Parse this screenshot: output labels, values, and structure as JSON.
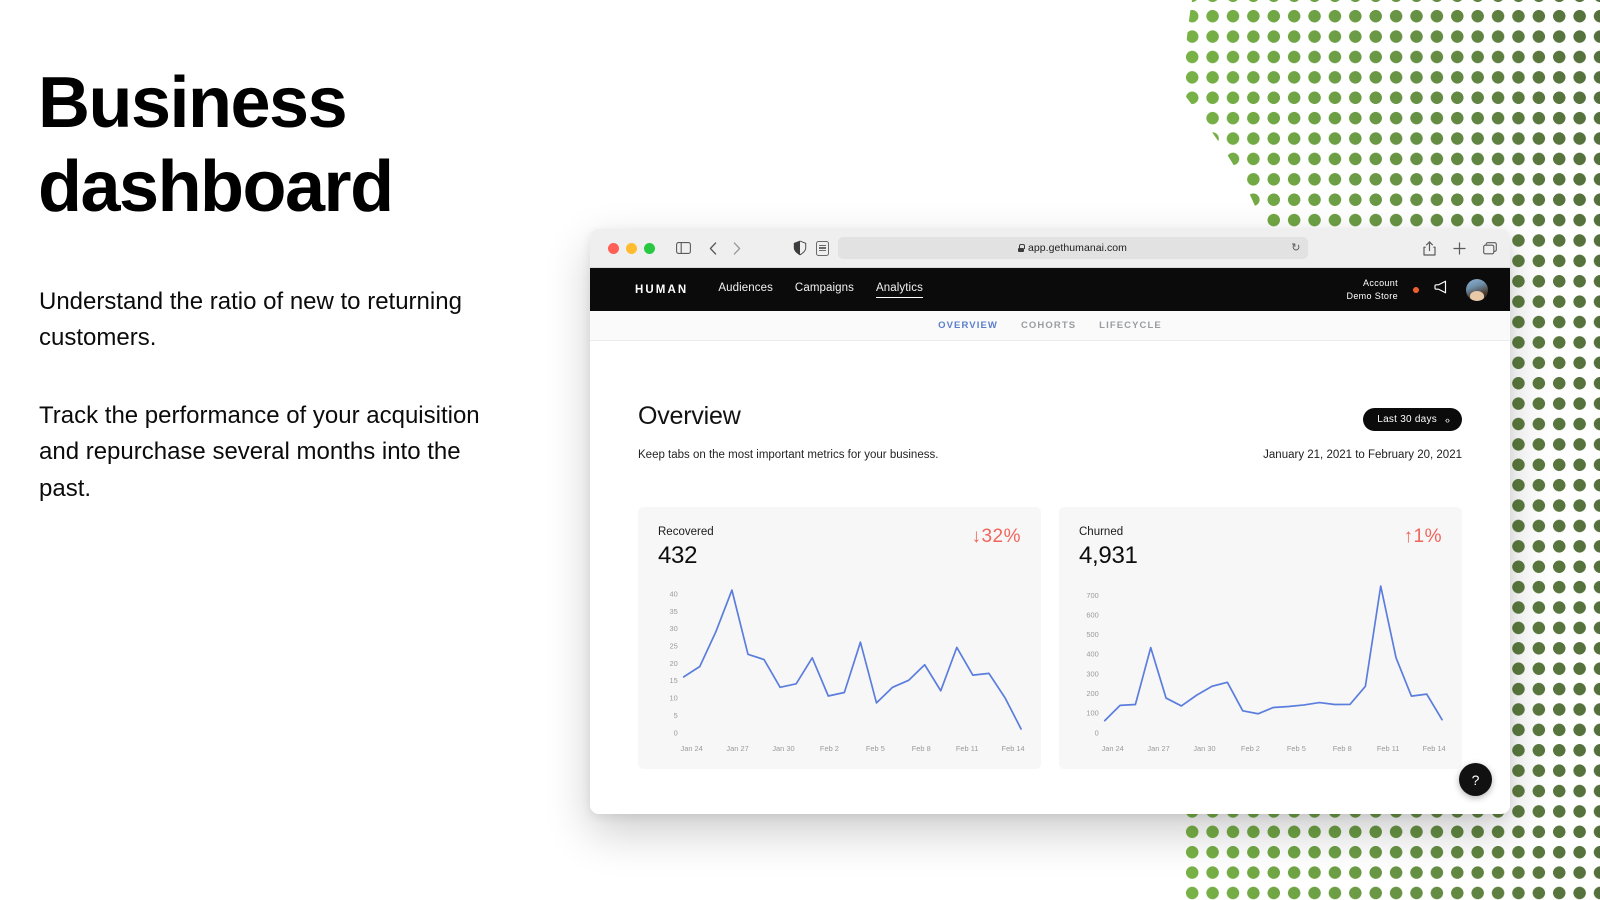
{
  "hero": {
    "title_line1": "Business",
    "title_line2": "dashboard",
    "paragraph1": "Understand the ratio of new to returning customers.",
    "paragraph2": "Track the performance of your acquisition and repurchase several months into the past."
  },
  "browser": {
    "url": "app.gethumanai.com",
    "reload_glyph": "↻",
    "share_glyph": "↑",
    "newtab_glyph": "+",
    "tabs_glyph": "⧉",
    "back_glyph": "‹",
    "forward_glyph": "›"
  },
  "appnav": {
    "logo": "HUMAN",
    "links": [
      {
        "label": "Audiences",
        "active": false
      },
      {
        "label": "Campaigns",
        "active": false
      },
      {
        "label": "Analytics",
        "active": true
      }
    ],
    "account_label": "Account",
    "account_store": "Demo Store"
  },
  "subtabs": [
    {
      "label": "OVERVIEW",
      "active": true
    },
    {
      "label": "COHORTS",
      "active": false
    },
    {
      "label": "LIFECYCLE",
      "active": false
    }
  ],
  "overview": {
    "title": "Overview",
    "subtitle": "Keep tabs on the most important metrics for your business.",
    "date_pill": "Last 30 days",
    "date_pill_chevrons": "‹›",
    "date_range": "January 21, 2021 to February 20, 2021"
  },
  "help_button": {
    "label": "?"
  },
  "colors": {
    "accent_line": "#5b7ddd",
    "delta_red": "#f0655c",
    "tab_active": "#5b7ecb",
    "nav_bg": "#0b0b0b",
    "card_bg": "#f7f7f7",
    "dot_green_light": "#79B347",
    "dot_green_dark": "#546F3C"
  },
  "cards": [
    {
      "label": "Recovered",
      "value": "432",
      "delta": "↓32%",
      "delta_direction": "down"
    },
    {
      "label": "Churned",
      "value": "4,931",
      "delta": "↑1%",
      "delta_direction": "up"
    }
  ],
  "chart_data": [
    {
      "type": "line",
      "title": "Recovered",
      "xlabel": "",
      "ylabel": "",
      "ylim": [
        0,
        43
      ],
      "yticks": [
        0,
        5,
        10,
        15,
        20,
        25,
        30,
        35,
        40
      ],
      "xticks": [
        "Jan 24",
        "Jan 27",
        "Jan 30",
        "Feb 2",
        "Feb 5",
        "Feb 8",
        "Feb 11",
        "Feb 14"
      ],
      "grid": false,
      "legend": "none",
      "values": [
        16,
        19,
        29,
        41,
        22.5,
        21,
        13,
        14,
        21.5,
        10.5,
        11.5,
        26,
        8.5,
        13,
        15,
        19.5,
        12,
        24.5,
        16.5,
        17,
        10,
        1
      ]
    },
    {
      "type": "line",
      "title": "Churned",
      "xlabel": "",
      "ylabel": "",
      "ylim": [
        0,
        760
      ],
      "yticks": [
        0,
        100,
        200,
        300,
        400,
        500,
        600,
        700
      ],
      "xticks": [
        "Jan 24",
        "Jan 27",
        "Jan 30",
        "Feb 2",
        "Feb 5",
        "Feb 8",
        "Feb 11",
        "Feb 14"
      ],
      "grid": false,
      "legend": "none",
      "values": [
        60,
        138,
        142,
        432,
        175,
        135,
        190,
        235,
        255,
        110,
        95,
        127,
        132,
        140,
        152,
        142,
        143,
        235,
        745,
        380,
        185,
        195,
        65
      ]
    }
  ]
}
